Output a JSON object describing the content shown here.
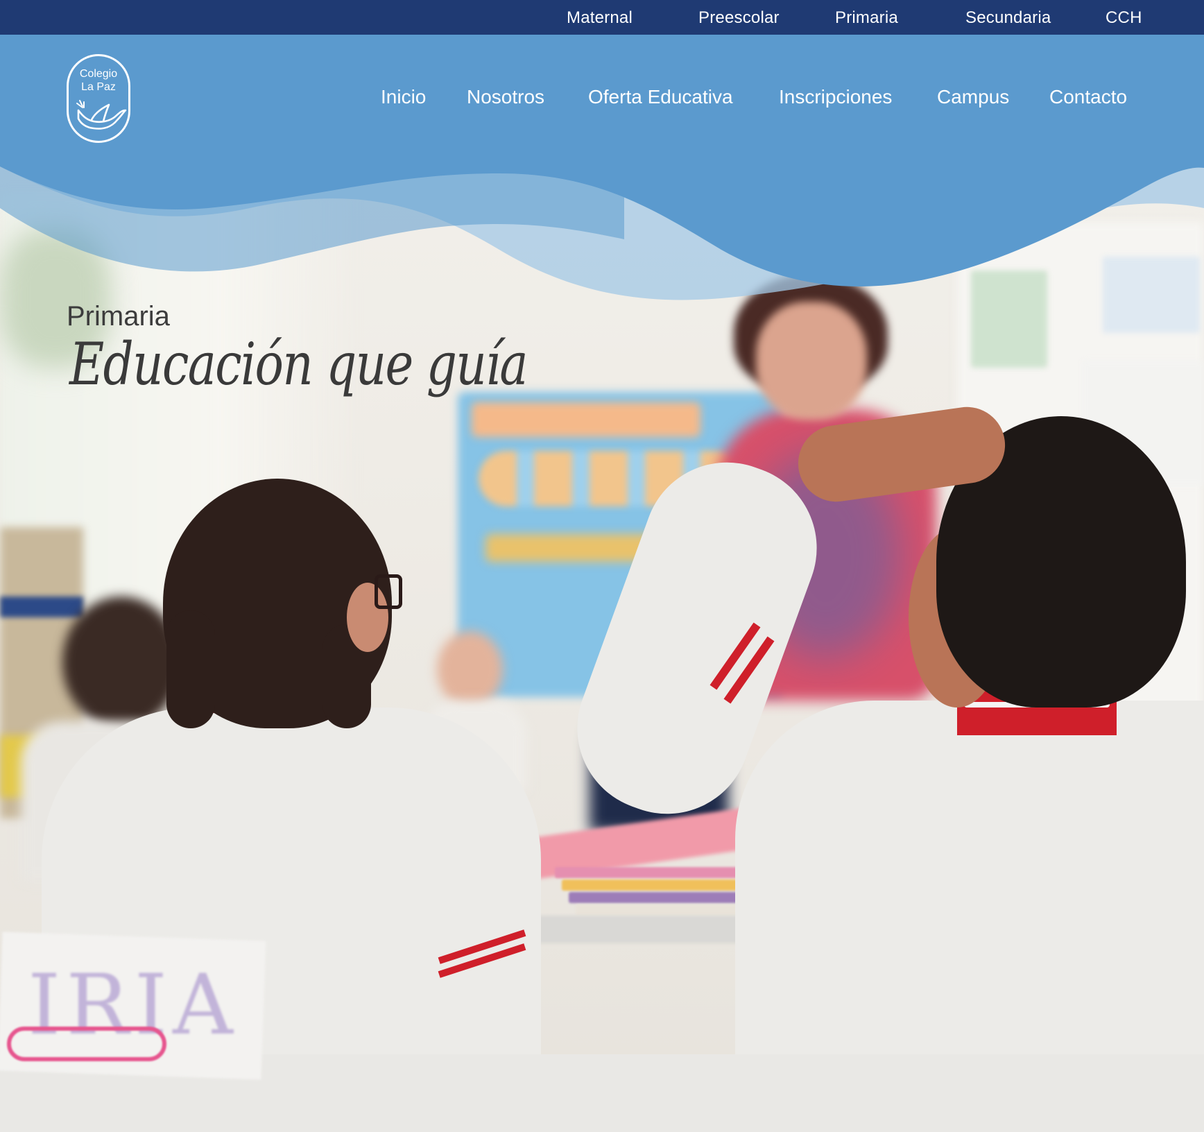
{
  "topbar": {
    "items": [
      {
        "label": "Maternal"
      },
      {
        "label": "Preescolar"
      },
      {
        "label": "Primaria"
      },
      {
        "label": "Secundaria"
      },
      {
        "label": "CCH"
      }
    ]
  },
  "logo": {
    "line1": "Colegio",
    "line2": "La Paz",
    "icon": "dove-icon"
  },
  "nav": {
    "items": [
      {
        "label": "Inicio"
      },
      {
        "label": "Nosotros"
      },
      {
        "label": "Oferta Educativa"
      },
      {
        "label": "Inscripciones"
      },
      {
        "label": "Campus"
      },
      {
        "label": "Contacto"
      }
    ]
  },
  "hero": {
    "subtitle": "Primaria",
    "title": "Educación que guía",
    "name_card_text": "IRIA"
  },
  "colors": {
    "topbar": "#1f3a73",
    "header": "#5b9ace",
    "wave_light": "#9fc6e6",
    "accent_red": "#cf1f2a",
    "text_dark": "#3a3a3a"
  }
}
